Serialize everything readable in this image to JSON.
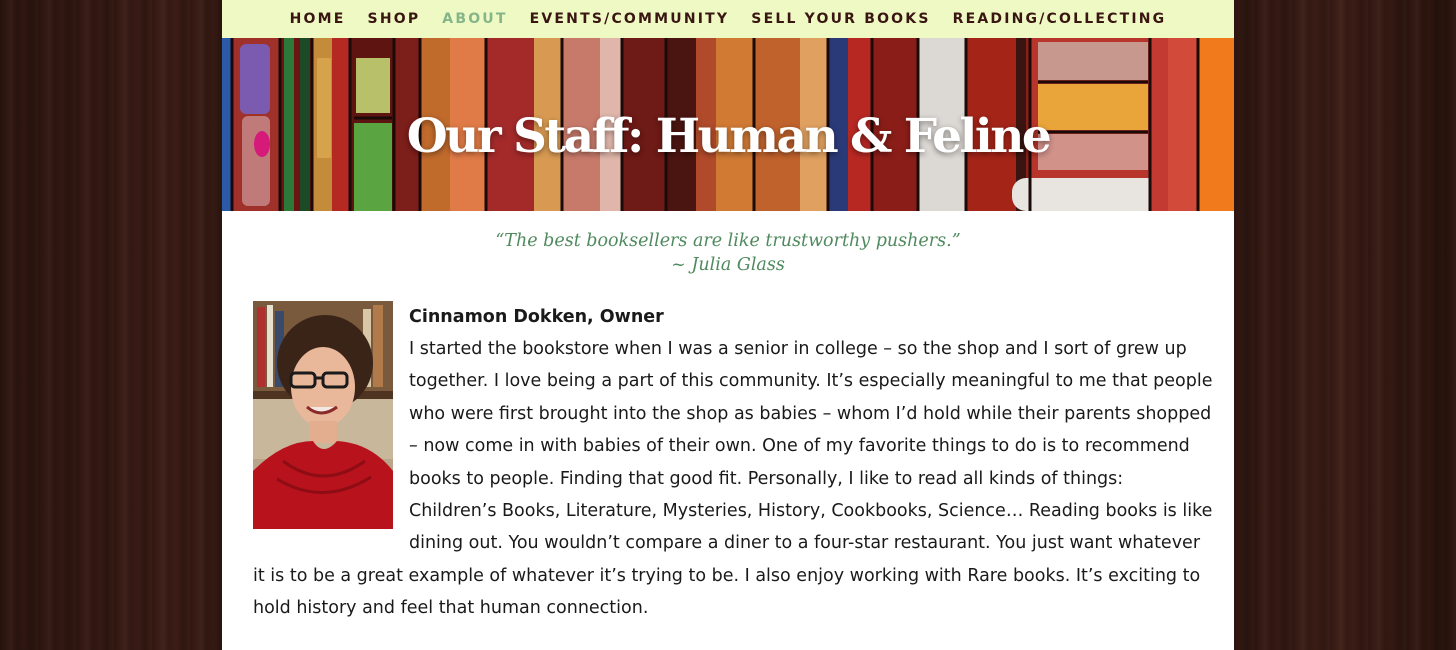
{
  "nav": {
    "items": [
      {
        "label": "HOME",
        "name": "nav-home",
        "active": false
      },
      {
        "label": "SHOP",
        "name": "nav-shop",
        "active": false
      },
      {
        "label": "ABOUT",
        "name": "nav-about",
        "active": true
      },
      {
        "label": "EVENTS/COMMUNITY",
        "name": "nav-events-community",
        "active": false
      },
      {
        "label": "SELL YOUR BOOKS",
        "name": "nav-sell-your-books",
        "active": false
      },
      {
        "label": "READING/COLLECTING",
        "name": "nav-reading-collecting",
        "active": false
      }
    ],
    "active_color": "#86b58a",
    "text_color": "#3a1612",
    "background": "#eef9c4"
  },
  "hero": {
    "title": "Our Staff: Human & Feline",
    "image": "stained-glass-books-banner"
  },
  "quote": {
    "text": "“The best booksellers are like trustworthy pushers.”",
    "author": "~ Julia Glass",
    "color": "#4f8a5e"
  },
  "staff": [
    {
      "name": "Cinnamon Dokken, Owner",
      "photo": "cinnamon-dokken-portrait",
      "bio": "I started the bookstore when I was a senior in college – so the shop and I sort of grew up together. I love being a part of this community. It’s especially meaningful to me that people who were first brought into the shop as babies – whom I’d hold while their parents shopped – now come in with babies of their own. One of my favorite things to do is to recommend books to people. Finding that good fit. Personally, I like to read all kinds of things: Children’s Books, Literature, Mysteries, History, Cookbooks, Science… Reading books is like dining out. You wouldn’t compare a diner to a four-star restaurant. You just want whatever it is to be a great example of whatever it’s trying to be. I also enjoy working with Rare books. It’s exciting to hold history and feel that human connection."
    }
  ]
}
